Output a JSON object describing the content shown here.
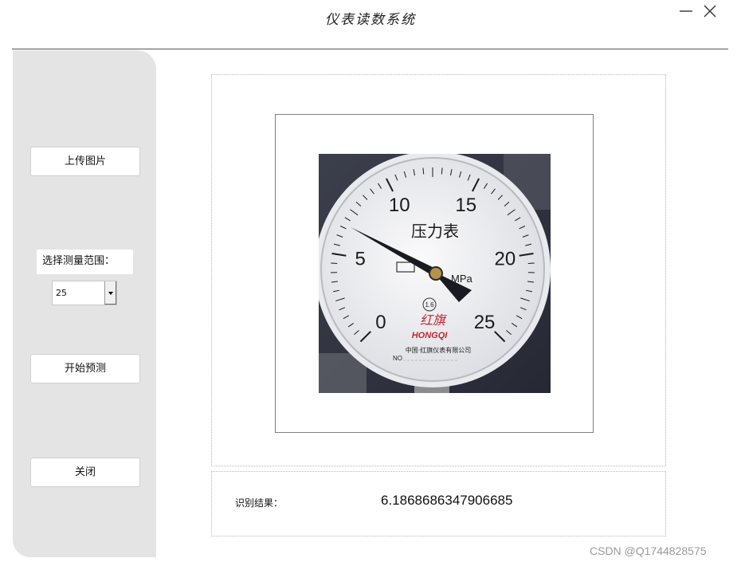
{
  "window": {
    "title": "仪表读数系统",
    "minimize_icon": "minimize-icon",
    "close_icon": "close-icon"
  },
  "sidebar": {
    "upload_label": "上传图片",
    "range_label": "选择测量范围：",
    "range_selected": "25",
    "predict_label": "开始预测",
    "close_label": "关闭"
  },
  "gauge_photo": {
    "dial_title": "压力表",
    "unit": "MPa",
    "scale_labels": [
      "0",
      "5",
      "10",
      "15",
      "20",
      "25"
    ],
    "accuracy_class": "1.6",
    "brand_script": "红旗",
    "brand": "HONGQI",
    "maker": "中国·红旗仪表有限公司",
    "serial_prefix": "NO"
  },
  "result": {
    "label": "识别结果：",
    "value": "6.1868686347906685"
  },
  "watermark": "CSDN @Q1744828575",
  "colors": {
    "sidebar_bg": "#e4e4e4",
    "needle": "#1a1a22",
    "dial_face": "#f4f4f6"
  }
}
